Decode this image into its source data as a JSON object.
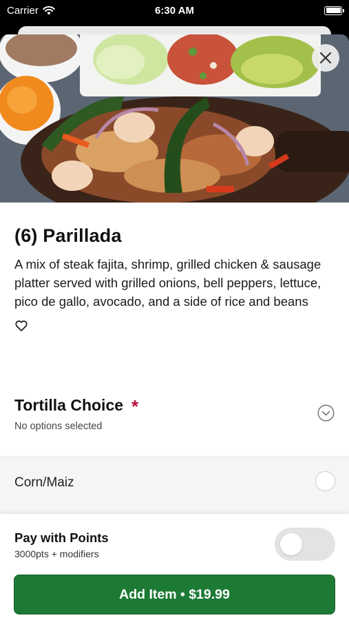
{
  "status_bar": {
    "carrier": "Carrier",
    "time": "6:30 AM",
    "wifi_icon": "wifi-icon",
    "battery_icon": "battery-icon"
  },
  "hero": {
    "image_icon": "fajita-platter-photo",
    "close_icon": "close-icon"
  },
  "item": {
    "title": "(6) Parillada",
    "description": "A mix of steak fajita, shrimp, grilled chicken & sausage platter served with grilled onions, bell peppers, lettuce, pico de gallo, avocado, and a side of rice and beans",
    "favorite_icon": "heart-outline-icon"
  },
  "tortilla_section": {
    "title": "Tortilla Choice",
    "required_mark": "*",
    "subtitle": "No options selected",
    "expand_icon": "chevron-down-circle-icon",
    "options": [
      {
        "label": "Corn/Maiz",
        "selected": false
      }
    ]
  },
  "footer": {
    "points_title": "Pay with Points",
    "points_subtitle": "3000pts + modifiers",
    "points_toggle_on": false,
    "add_button_label": "Add Item • $19.99"
  },
  "colors": {
    "accent_green": "#1d7a35",
    "required_red": "#b3123d"
  }
}
